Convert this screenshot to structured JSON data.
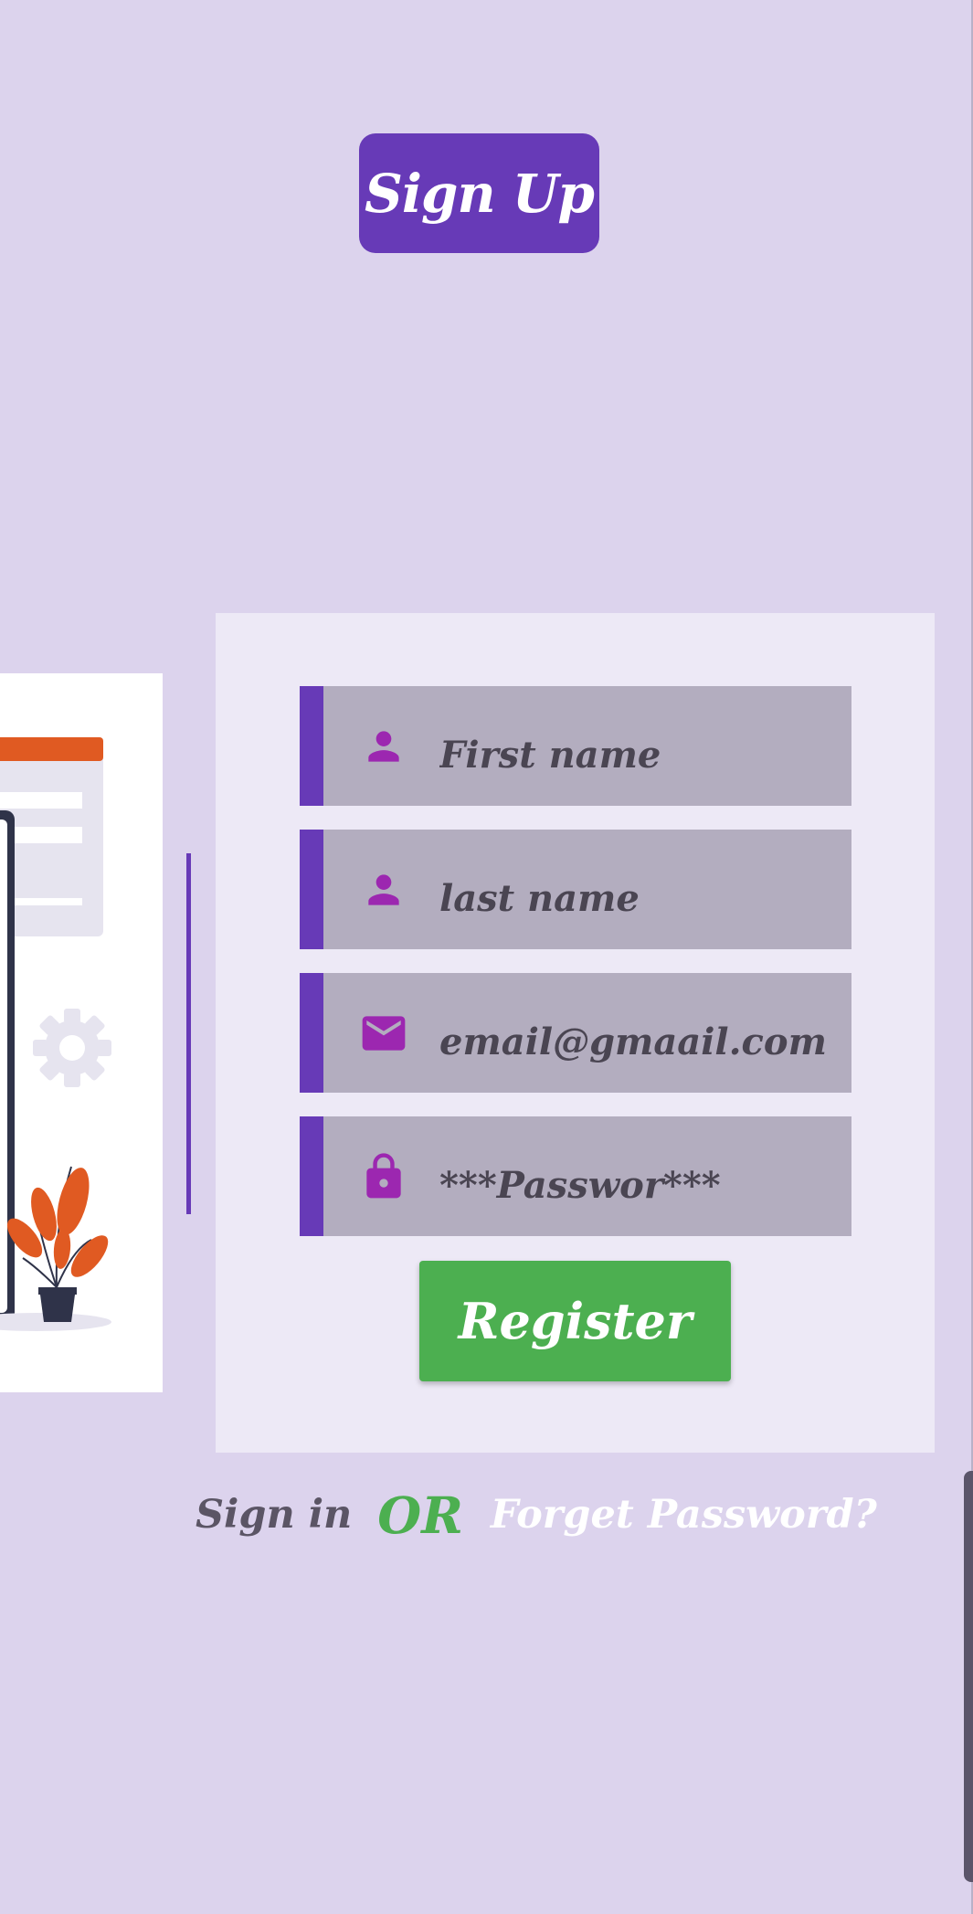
{
  "header": {
    "signup_label": "Sign Up"
  },
  "form": {
    "first_name": {
      "value": "First name",
      "icon": "person-icon"
    },
    "last_name": {
      "value": "last name",
      "icon": "person-icon"
    },
    "email": {
      "value": "email@gmaail.com",
      "icon": "email-icon"
    },
    "password": {
      "value": "***Passwor***",
      "icon": "lock-icon"
    },
    "register_label": "Register"
  },
  "footer": {
    "signin_label": "Sign in",
    "or_label": "OR",
    "forget_label": "Forget Password?"
  },
  "colors": {
    "background": "#dcd3ed",
    "accent": "#673ab7",
    "icon": "#9c27b0",
    "field": "#b3adbf",
    "register": "#4caf50"
  }
}
